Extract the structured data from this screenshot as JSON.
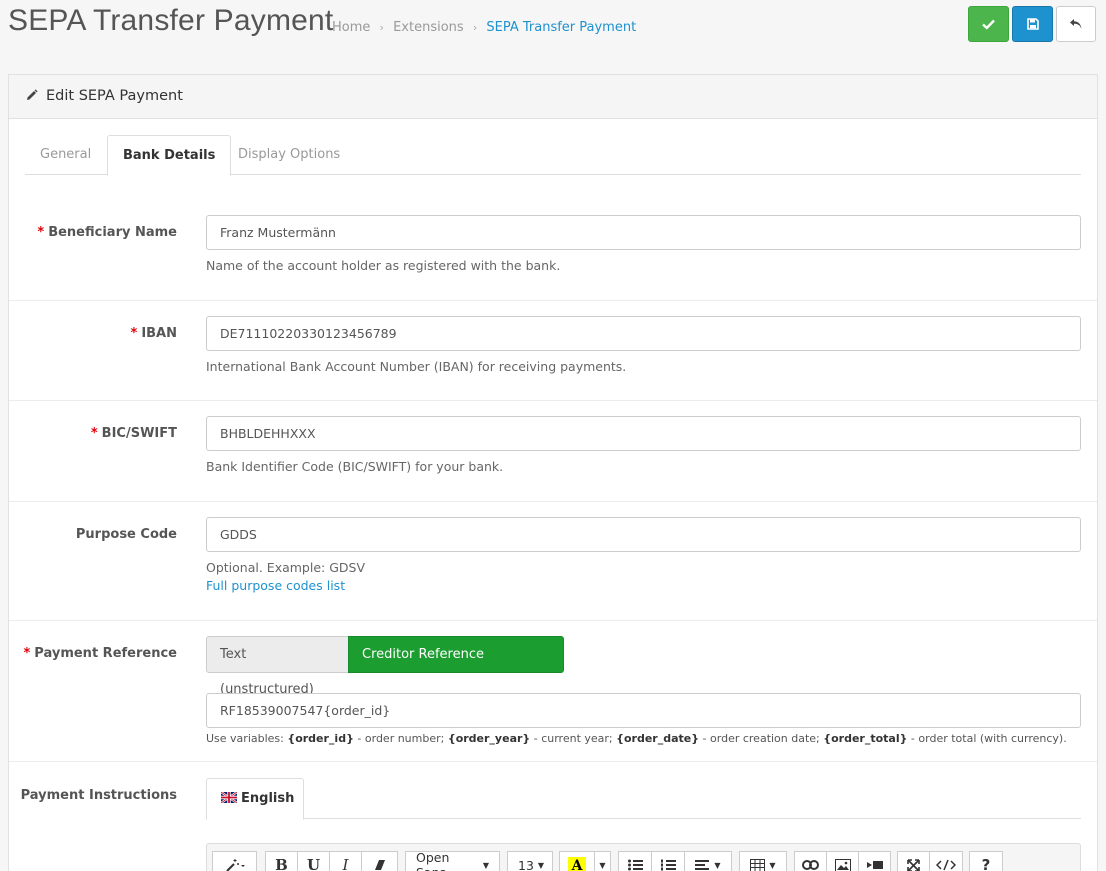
{
  "header": {
    "title": "SEPA Transfer Payment",
    "breadcrumb": [
      "Home",
      "Extensions",
      "SEPA Transfer Payment"
    ],
    "breadcrumb_sep": "›"
  },
  "panel": {
    "title": "Edit SEPA Payment",
    "tabs": [
      "General",
      "Bank Details",
      "Display Options"
    ]
  },
  "form": {
    "required_mark": "*",
    "beneficiary": {
      "label": "Beneficiary Name",
      "value": "Franz Mustermänn",
      "help": "Name of the account holder as registered with the bank."
    },
    "iban": {
      "label": "IBAN",
      "value": "DE71110220330123456789",
      "help": "International Bank Account Number (IBAN) for receiving payments."
    },
    "bic": {
      "label": "BIC/SWIFT",
      "value": "BHBLDEHHXXX",
      "help": "Bank Identifier Code (BIC/SWIFT) for your bank."
    },
    "purpose": {
      "label": "Purpose Code",
      "value": "GDDS",
      "help": "Optional. Example: GDSV",
      "link": "Full purpose codes list"
    },
    "reference": {
      "label": "Payment Reference",
      "option_text": "Text (unstructured)",
      "option_creditor": "Creditor Reference (structured)",
      "value": "RF18539007547{order_id}",
      "help_prefix": "Use variables: ",
      "var1": "{order_id}",
      "desc1": " - order number; ",
      "var2": "{order_year}",
      "desc2": " - current year; ",
      "var3": "{order_date}",
      "desc3": " - order creation date; ",
      "var4": "{order_total}",
      "desc4": " - order total (with currency)."
    },
    "instructions": {
      "label": "Payment Instructions",
      "language": "English",
      "toolbar": {
        "font": "Open Sans",
        "size": "13",
        "bold": "B",
        "underline": "U",
        "italic": "I",
        "help": "?"
      }
    }
  },
  "colors": {
    "save": "#4cb64c",
    "primary": "#1e91cf",
    "toggle_active": "#1c9d30",
    "required": "#e3000b"
  }
}
